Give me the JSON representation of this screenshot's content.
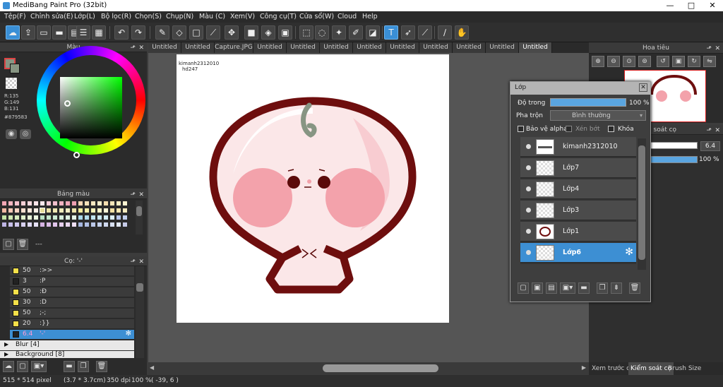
{
  "window": {
    "title": "MediBang Paint Pro (32bit)",
    "controls": [
      "—",
      "□",
      "✕"
    ]
  },
  "menu": [
    "Tệp(F)",
    "Chỉnh sửa(E)",
    "Lớp(L)",
    "Bộ lọc(R)",
    "Chọn(S)",
    "Chụp(N)",
    "Màu (C)",
    "Xem(V)",
    "Công cụ(T)",
    "Cửa sổ(W)",
    "Cloud",
    "Help"
  ],
  "toolbar": {
    "icons": [
      "cloud-sync-icon",
      "share-icon",
      "comment-icon",
      "comment2-icon",
      "page-icon",
      "grid-icon",
      "multi-icon",
      "undo-icon",
      "redo-icon",
      "pen-icon",
      "eraser-icon",
      "dot-icon",
      "brush-icon",
      "move-icon",
      "fill-rect-icon",
      "bucket-icon",
      "gradient-icon",
      "select-rect-icon",
      "lasso-icon",
      "magic-wand-icon",
      "select-pen-icon",
      "select-eraser-icon",
      "text-icon",
      "operation-icon",
      "dropper-icon",
      "divide-icon",
      "hand-icon"
    ]
  },
  "color_panel": {
    "title": "Màu",
    "r": "R:135",
    "g": "G:149",
    "b": "B:131",
    "hex": "#879583",
    "accent": "#879583"
  },
  "palette_panel": {
    "title": "Bảng màu",
    "footer": "---"
  },
  "brush_panel": {
    "title": "Cọ: '-'",
    "items": [
      {
        "size": "50",
        "name": ":>>",
        "color": "#f4e04a"
      },
      {
        "size": "3",
        "name": ":P",
        "color": "#222222"
      },
      {
        "size": "50",
        "name": ":Đ",
        "color": "#f4e04a"
      },
      {
        "size": "30",
        "name": ":D",
        "color": "#f4e04a"
      },
      {
        "size": "50",
        "name": ";-;",
        "color": "#f4e04a"
      },
      {
        "size": "20",
        "name": ":}}",
        "color": "#f4e04a"
      },
      {
        "size": "6.4",
        "name": "'-'",
        "color": "#222222"
      }
    ],
    "groups": [
      "Blur [4]",
      "Background [8]"
    ]
  },
  "tabs": [
    "Untitled",
    "Untitled",
    "Capture.JPG",
    "Untitled",
    "Untitled",
    "Untitled",
    "Untitled",
    "Untitled",
    "Untitled",
    "Untitled",
    "Untitled",
    "Untitled"
  ],
  "canvas": {
    "watermark_line1": "kimanh2312010",
    "watermark_line2": "hd247"
  },
  "layer_dialog": {
    "title": "Lớp",
    "opacity_label": "Độ trong",
    "opacity_value": "100 %",
    "blend_label": "Pha trộn",
    "blend_value": "Bình thường",
    "protect_alpha": "Bảo vệ alpha",
    "clipping": "Xén bớt",
    "lock": "Khóa",
    "layers": [
      "kimanh2312010",
      "Lớp7",
      "Lớp4",
      "Lớp3",
      "Lớp1",
      "Lớp6"
    ]
  },
  "navigator": {
    "title": "Hoa tiêu"
  },
  "brush_control": {
    "title": "Kiểm soát cọ",
    "size": "6.4",
    "opacity": "100 %"
  },
  "right_tabs": [
    "Xem trước cọ",
    "Kiểm soát cọ",
    "Brush Size"
  ],
  "status": {
    "size": "515 * 514 pixel",
    "dims": "(3.7 * 3.7cm)",
    "dpi": "350 dpi",
    "zoom": "100 %",
    "coord": "( -39, 6 )"
  }
}
